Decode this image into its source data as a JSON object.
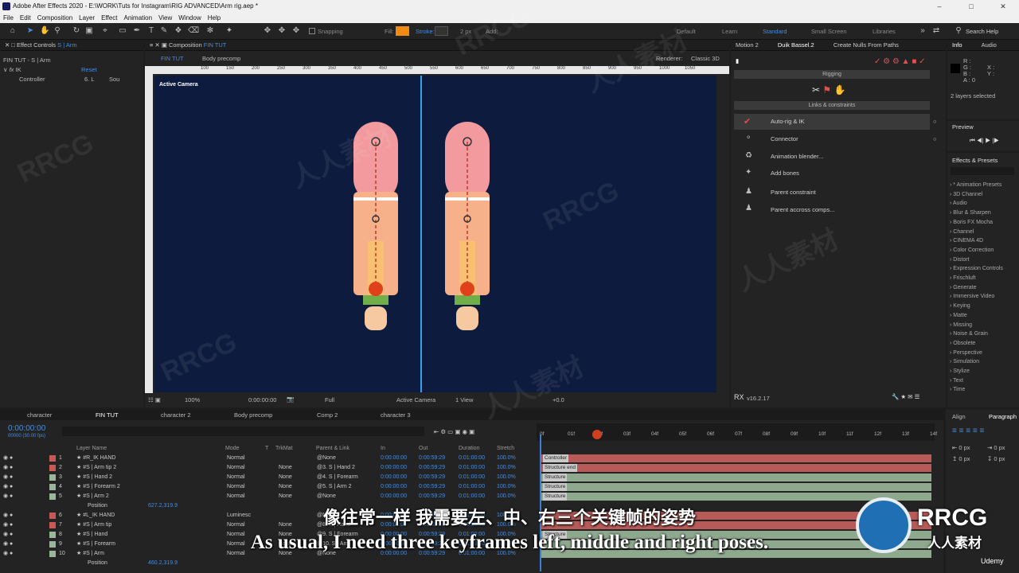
{
  "window": {
    "title": "Adobe After Effects 2020 - E:\\WORK\\Tuts for Instagram\\RIG ADVANCED\\Arm rig.aep *"
  },
  "menu": [
    "File",
    "Edit",
    "Composition",
    "Layer",
    "Effect",
    "Animation",
    "View",
    "Window",
    "Help"
  ],
  "toolbar": {
    "snapping": "Snapping",
    "fill": "Fill:",
    "stroke": "Stroke:",
    "stroke_val": "2 px",
    "add": "Add:",
    "workspaces": [
      "Default",
      "Learn",
      "Standard",
      "Small Screen",
      "Libraries"
    ],
    "search": "Search Help"
  },
  "effect_controls": {
    "tab": "Effect Controls",
    "layer": "S | Arm",
    "sub": "FIN TUT - S | Arm",
    "fx": "IK",
    "reset": "Reset",
    "controller_label": "Controller",
    "ctrl_val": "6. L",
    "src_val": "Sou"
  },
  "comp": {
    "tab": "Composition",
    "name": "FIN TUT",
    "subtabs": [
      "FIN TUT",
      "Body precomp"
    ],
    "renderer_label": "Renderer:",
    "renderer": "Classic 3D",
    "camera_label": "Active Camera",
    "ruler": [
      "100",
      "150",
      "200",
      "250",
      "300",
      "350",
      "400",
      "450",
      "500",
      "550",
      "600",
      "650",
      "700",
      "750",
      "800",
      "850",
      "900",
      "950",
      "1000",
      "1050"
    ],
    "footer": {
      "zoom": "100%",
      "time": "0:00:00:00",
      "res": "Full",
      "cam": "Active Camera",
      "view": "1 View",
      "offset": "+0.0"
    }
  },
  "duik": {
    "tabs": [
      "Motion 2",
      "Duik Bassel.2",
      "Create Nulls From Paths"
    ],
    "rigging": "Rigging",
    "links": "Links & constraints",
    "items": [
      "Auto-rig & IK",
      "Connector",
      "Animation blender...",
      "Add bones",
      "Parent constraint",
      "Parent accross comps..."
    ],
    "version": "v16.2.17"
  },
  "info": {
    "tabs": [
      "Info",
      "Audio"
    ],
    "r": "R :",
    "g": "G :",
    "b": "B :",
    "a": "A : 0",
    "x": "X :",
    "y": "Y :",
    "selected": "2 layers selected"
  },
  "preview": {
    "title": "Preview"
  },
  "effects_presets": {
    "title": "Effects & Presets",
    "items": [
      "* Animation Presets",
      "3D Channel",
      "Audio",
      "Blur & Sharpen",
      "Boris FX Mocha",
      "Channel",
      "CINEMA 4D",
      "Color Correction",
      "Distort",
      "Expression Controls",
      "Frischluft",
      "Generate",
      "Immersive Video",
      "Keying",
      "Matte",
      "Missing",
      "Noise & Grain",
      "Obsolete",
      "Perspective",
      "Simulation",
      "Stylize",
      "Text",
      "Time"
    ]
  },
  "timeline": {
    "tabs": [
      "character",
      "FIN TUT",
      "character 2",
      "Body precomp",
      "Comp 2",
      "character 3"
    ],
    "timecode": "0:00:00:00",
    "fps": "00000 (30.00 fps)",
    "ticks": [
      "0f",
      "01f",
      "02f",
      "03f",
      "04f",
      "05f",
      "06f",
      "07f",
      "08f",
      "09f",
      "10f",
      "11f",
      "12f",
      "13f",
      "14f"
    ],
    "headers": {
      "name": "Layer Name",
      "mode": "Mode",
      "t": "T",
      "trkmat": "TrkMat",
      "parent": "Parent & Link",
      "in": "In",
      "out": "Out",
      "dur": "Duration",
      "stretch": "Stretch"
    },
    "layers": [
      {
        "num": "1",
        "name": "R_IK HAND",
        "mode": "Normal",
        "trk": "",
        "parent": "None",
        "in": "0:00:00:00",
        "out": "0:00:59:29",
        "dur": "0:01:00:00",
        "str": "100.0%",
        "bar": "Controller",
        "color": "#c85a55"
      },
      {
        "num": "2",
        "name": "S | Arm tip 2",
        "mode": "Normal",
        "trk": "None",
        "parent": "3. S | Hand 2",
        "in": "0:00:00:00",
        "out": "0:00:59:29",
        "dur": "0:01:00:00",
        "str": "100.0%",
        "bar": "Structure end",
        "color": "#c85a55"
      },
      {
        "num": "3",
        "name": "S | Hand 2",
        "mode": "Normal",
        "trk": "None",
        "parent": "4. S | Forearm",
        "in": "0:00:00:00",
        "out": "0:00:59:29",
        "dur": "0:01:00:00",
        "str": "100.0%",
        "bar": "Structure",
        "color": "#9ab59a"
      },
      {
        "num": "4",
        "name": "S | Forearm 2",
        "mode": "Normal",
        "trk": "None",
        "parent": "5. S | Arm 2",
        "in": "0:00:00:00",
        "out": "0:00:59:29",
        "dur": "0:01:00:00",
        "str": "100.0%",
        "bar": "Structure",
        "color": "#9ab59a"
      },
      {
        "num": "5",
        "name": "S | Arm 2",
        "mode": "Normal",
        "trk": "None",
        "parent": "None",
        "in": "0:00:00:00",
        "out": "0:00:59:29",
        "dur": "0:01:00:00",
        "str": "100.0%",
        "bar": "Structure",
        "color": "#9ab59a"
      },
      {
        "num": "6",
        "name": "L_IK HAND",
        "mode": "Luminesc",
        "trk": "",
        "parent": "None",
        "in": "0:00:00:00",
        "out": "0:00:59:29",
        "dur": "0:01:00:00",
        "str": "100.0%",
        "bar": "",
        "color": "#c85a55"
      },
      {
        "num": "7",
        "name": "S | Arm tip",
        "mode": "Normal",
        "trk": "None",
        "parent": "8. S | Hand",
        "in": "0:00:00:00",
        "out": "0:00:59:29",
        "dur": "0:01:00:00",
        "str": "100.0%",
        "bar": "",
        "color": "#c85a55"
      },
      {
        "num": "8",
        "name": "S | Hand",
        "mode": "Normal",
        "trk": "None",
        "parent": "9. S | Forearm",
        "in": "0:00:00:00",
        "out": "0:00:59:29",
        "dur": "0:01:00:00",
        "str": "100.0%",
        "bar": "Structure",
        "color": "#9ab59a"
      },
      {
        "num": "9",
        "name": "S | Forearm",
        "mode": "Normal",
        "trk": "None",
        "parent": "10. S | Arm",
        "in": "0:00:00:00",
        "out": "0:00:59:29",
        "dur": "0:01:00:00",
        "str": "100.0%",
        "bar": "",
        "color": "#9ab59a"
      },
      {
        "num": "10",
        "name": "S | Arm",
        "mode": "Normal",
        "trk": "None",
        "parent": "None",
        "in": "0:00:00:00",
        "out": "0:00:59:29",
        "dur": "0:01:00:00",
        "str": "100.0%",
        "bar": "",
        "color": "#9ab59a"
      }
    ],
    "position_label": "Position",
    "pos1": "627.2,319.9",
    "pos2": "460.2,319.9"
  },
  "align": {
    "tabs": [
      "Align",
      "Paragraph"
    ],
    "px": "0 px"
  },
  "subtitle": {
    "zh": "像往常一样 我需要左、中、右三个关键帧的姿势",
    "en": "As usual, I need three keyframes left, middle and right poses."
  },
  "watermarks": [
    "RRCG",
    "人人素材"
  ],
  "brand": {
    "logo": "RRCG",
    "sub": "人人素材",
    "udemy": "Udemy"
  }
}
